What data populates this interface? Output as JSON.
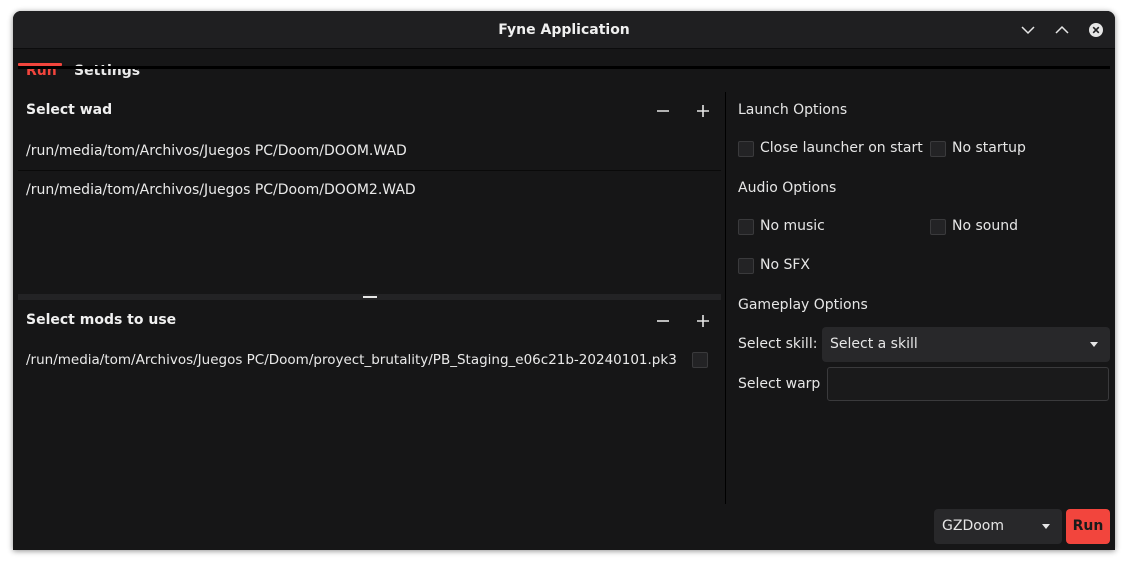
{
  "window": {
    "title": "Fyne Application"
  },
  "tabs": [
    {
      "label": "Run",
      "active": true
    },
    {
      "label": "Settings",
      "active": false
    }
  ],
  "wad_section": {
    "title": "Select wad",
    "items": [
      "/run/media/tom/Archivos/Juegos PC/Doom/DOOM.WAD",
      "/run/media/tom/Archivos/Juegos PC/Doom/DOOM2.WAD"
    ]
  },
  "mods_section": {
    "title": "Select mods to use",
    "items": [
      {
        "path": "/run/media/tom/Archivos/Juegos PC/Doom/proyect_brutality/PB_Staging_e06c21b-20240101.pk3",
        "checked": false
      }
    ]
  },
  "launch_options": {
    "title": "Launch Options",
    "close_launcher": "Close launcher on start",
    "no_startup": "No startup"
  },
  "audio_options": {
    "title": "Audio Options",
    "no_music": "No music",
    "no_sound": "No sound",
    "no_sfx": "No SFX"
  },
  "gameplay_options": {
    "title": "Gameplay Options",
    "skill_label": "Select skill:",
    "skill_placeholder": "Select a skill",
    "warp_label": "Select warp",
    "warp_value": ""
  },
  "footer": {
    "engine": "GZDoom",
    "run_label": "Run"
  },
  "colors": {
    "accent": "#f2453d",
    "background": "#161617",
    "surface": "#28282a"
  }
}
